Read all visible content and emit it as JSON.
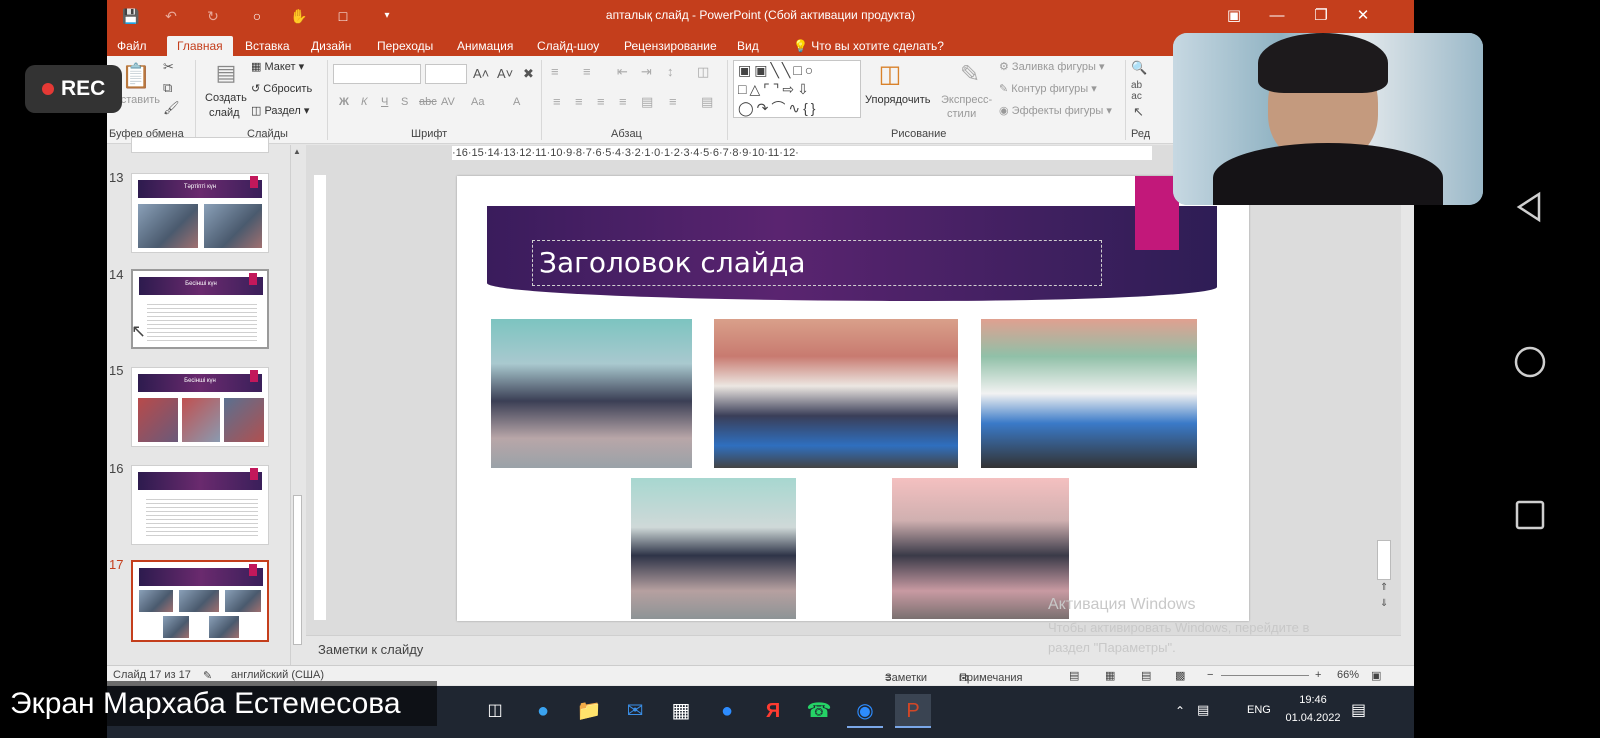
{
  "window": {
    "title": "апталық слайд - PowerPoint (Сбой активации продукта)",
    "tabs": [
      "Файл",
      "Главная",
      "Вставка",
      "Дизайн",
      "Переходы",
      "Анимация",
      "Слайд-шоу",
      "Рецензирование",
      "Вид"
    ],
    "tell_me": "Что вы хотите сделать?",
    "active_tab": "Главная"
  },
  "ribbon": {
    "clipboard": {
      "paste": "вставить",
      "group": "Буфер обмена"
    },
    "slides": {
      "new_slide_line1": "Создать",
      "new_slide_line2": "слайд",
      "layout": "Макет",
      "reset": "Сбросить",
      "section": "Раздел",
      "group": "Слайды"
    },
    "font": {
      "group": "Шрифт",
      "bold": "Ж",
      "italic": "К",
      "underline": "Ч",
      "shadow": "S",
      "strike": "abc",
      "spacing": "AV",
      "case": "Aa",
      "color": "A"
    },
    "paragraph": {
      "group": "Абзац"
    },
    "drawing": {
      "arrange": "Упорядочить",
      "quick_styles_1": "Экспресс-",
      "quick_styles_2": "стили",
      "fill": "Заливка фигуры",
      "outline": "Контур фигуры",
      "effects": "Эффекты фигуры",
      "group": "Рисование"
    },
    "editing": {
      "group": "Ред"
    }
  },
  "thumbnails": [
    {
      "num": "13",
      "title": "Тәртіпті күн"
    },
    {
      "num": "14",
      "title": "Бесінші күн"
    },
    {
      "num": "15",
      "title": "Бесінші күн"
    },
    {
      "num": "16",
      "title": ""
    },
    {
      "num": "17",
      "title": ""
    }
  ],
  "ruler_text": "·16·15·14·13·12·11·10·9·8·7·6·5·4·3·2·1·0·1·2·3·4·5·6·7·8·9·10·11·12·",
  "slide": {
    "title": "Заголовок слайда"
  },
  "notes_placeholder": "Заметки к слайду",
  "status": {
    "slide_of": "Слайд 17 из 17",
    "language": "английский (США)",
    "notes": "Заметки",
    "comments": "Примечания",
    "zoom": "66%"
  },
  "taskbar": {
    "lang": "ENG",
    "time": "19:46",
    "date": "01.04.2022"
  },
  "overlay": {
    "rec": "REC",
    "presenter": "Экран Мархаба Естемесова",
    "watermark_title": "Активация Windows",
    "watermark_body": "Чтобы активировать Windows, перейдите в раздел \"Параметры\"."
  },
  "colors": {
    "accent": "#c43e1c",
    "banner": "#3a1c5c",
    "pink": "#c2187a"
  }
}
